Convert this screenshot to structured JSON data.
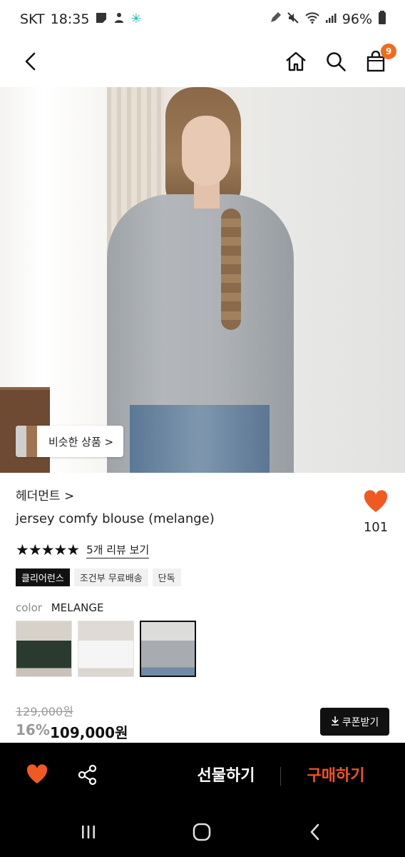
{
  "status_bar": {
    "carrier": "SKT",
    "time": "18:35",
    "battery": "96%",
    "icons_left": [
      "sticky-note-icon",
      "notification-icon",
      "teal-snowflake-icon"
    ],
    "icons_right": [
      "edit-icon",
      "mute-icon",
      "wifi-icon",
      "signal-icon",
      "battery-icon"
    ]
  },
  "nav": {
    "back_icon": "chevron-left-icon",
    "home_icon": "home-icon",
    "search_icon": "search-icon",
    "cart_icon": "shopping-bag-icon",
    "cart_count": "9"
  },
  "hero": {
    "similar_button_label": "비슷한 상품 >"
  },
  "product": {
    "brand": "헤더먼트 >",
    "name": "jersey comfy blouse (melange)",
    "like_count": "101",
    "rating_stars": "★★★★★",
    "rating": 5,
    "review_link": "5개 리뷰 보기",
    "tags": [
      {
        "label": "클리어런스",
        "style": "dark"
      },
      {
        "label": "조건부 무료배송",
        "style": "light"
      },
      {
        "label": "단독",
        "style": "light"
      }
    ],
    "color_label": "color",
    "color_value": "MELANGE",
    "swatches": [
      "green",
      "white",
      "melange"
    ],
    "selected_swatch": "melange",
    "original_price": "129,000원",
    "discount": "16%",
    "price": "109,000원",
    "coupon_button": "쿠폰받기"
  },
  "bottom_bar": {
    "gift_label": "선물하기",
    "buy_label": "구매하기"
  },
  "colors": {
    "accent_orange": "#f2531e",
    "heart_orange": "#f05a22",
    "badge_orange": "#f26a1b"
  }
}
